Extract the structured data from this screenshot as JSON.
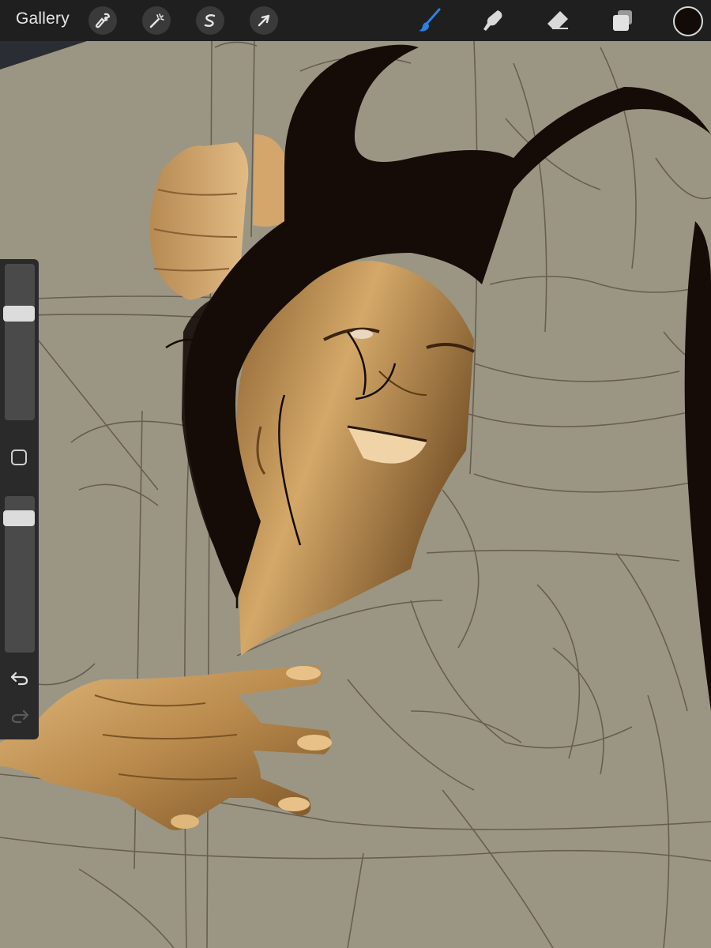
{
  "toolbar": {
    "gallery_label": "Gallery",
    "left_tools": [
      {
        "name": "actions",
        "icon": "wrench-icon"
      },
      {
        "name": "adjustments",
        "icon": "magic-wand-icon"
      },
      {
        "name": "selection",
        "icon": "selection-s-icon"
      },
      {
        "name": "transform",
        "icon": "arrow-cursor-icon"
      }
    ],
    "right_tools": [
      {
        "name": "brush",
        "icon": "brush-icon",
        "active": true
      },
      {
        "name": "smudge",
        "icon": "smudge-finger-icon",
        "active": false
      },
      {
        "name": "eraser",
        "icon": "eraser-icon",
        "active": false
      },
      {
        "name": "layers",
        "icon": "layers-icon",
        "active": false
      }
    ],
    "current_color": "#120b08",
    "active_tool_color": "#2f7fe6"
  },
  "sidebar": {
    "brush_size_level": 0.7,
    "opacity_level": 0.9,
    "modify_icon": "square-modify-icon",
    "undo_icon": "undo-icon",
    "redo_icon": "redo-icon"
  },
  "canvas": {
    "background_color": "#9b9683",
    "sketch_color": "#5e554a",
    "skin_color": "#c89b5c",
    "hair_color": "#150c08"
  }
}
